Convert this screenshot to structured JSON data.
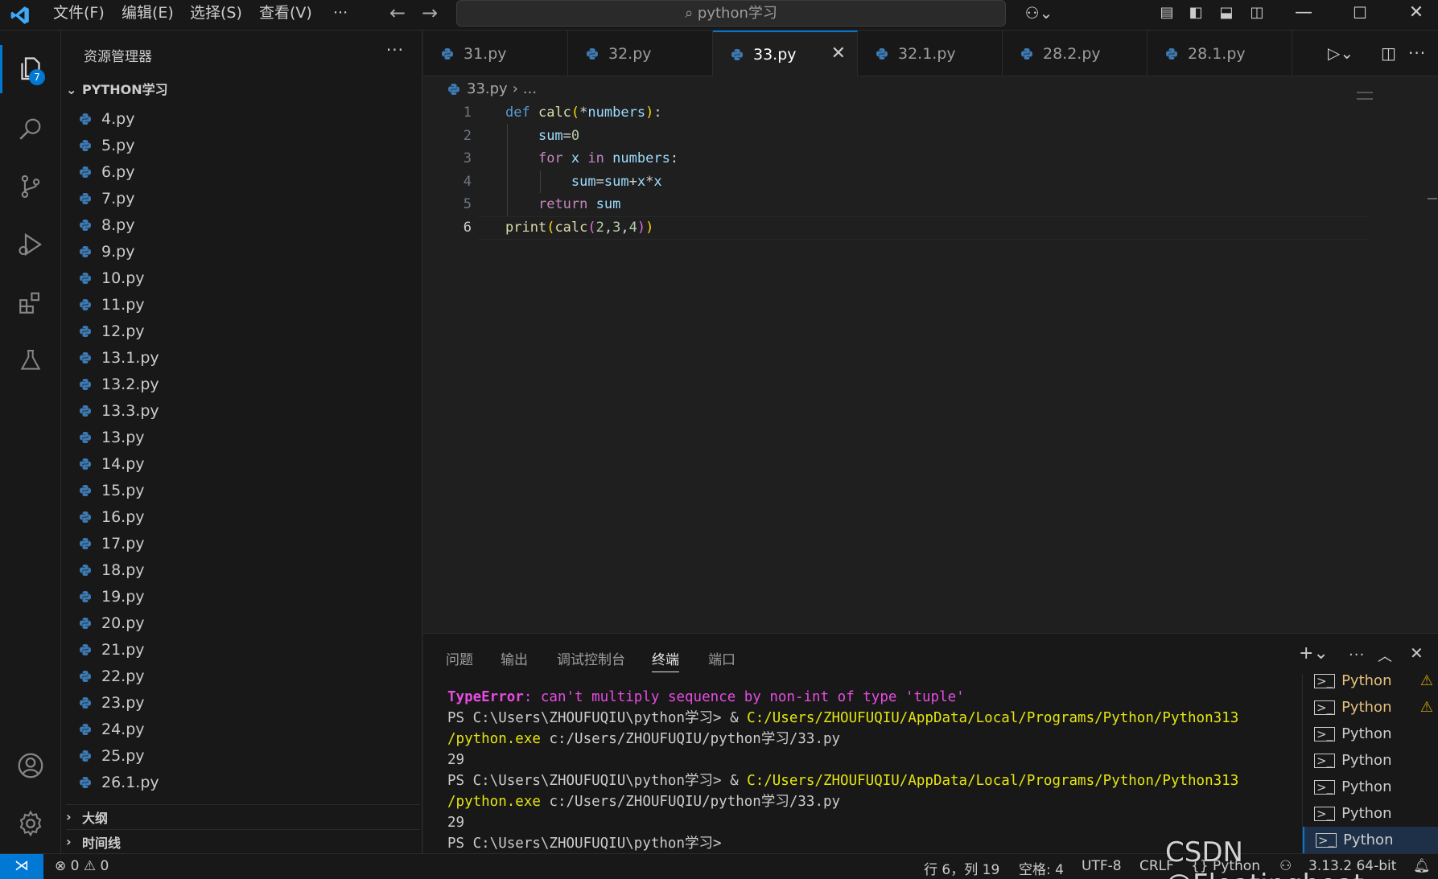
{
  "titlebar": {
    "menus": [
      "文件(F)",
      "编辑(E)",
      "选择(S)",
      "查看(V)",
      "···"
    ],
    "search": "python学习"
  },
  "activity": {
    "explorer_badge": "7"
  },
  "sidebar": {
    "title": "资源管理器",
    "more": "···",
    "folder": "PYTHON学习",
    "files": [
      "4.py",
      "5.py",
      "6.py",
      "7.py",
      "8.py",
      "9.py",
      "10.py",
      "11.py",
      "12.py",
      "13.1.py",
      "13.2.py",
      "13.3.py",
      "13.py",
      "14.py",
      "15.py",
      "16.py",
      "17.py",
      "18.py",
      "19.py",
      "20.py",
      "21.py",
      "22.py",
      "23.py",
      "24.py",
      "25.py",
      "26.1.py"
    ],
    "outline": "大纲",
    "timeline": "时间线"
  },
  "tabs": [
    "31.py",
    "32.py",
    "33.py",
    "32.1.py",
    "28.2.py",
    "28.1.py"
  ],
  "active_tab": "33.py",
  "breadcrumb": {
    "file": "33.py",
    "rest": "..."
  },
  "editor": {
    "line_numbers": [
      "1",
      "2",
      "3",
      "4",
      "5",
      "6"
    ],
    "lines": [
      "def calc(*numbers):",
      "    sum=0",
      "    for x in numbers:",
      "        sum=sum+x*x",
      "    return sum",
      "print(calc(2,3,4))"
    ]
  },
  "panel": {
    "tabs": [
      "问题",
      "输出",
      "调试控制台",
      "终端",
      "端口"
    ],
    "active_tab": "终端",
    "terminal": {
      "err_type": "TypeError",
      "err_msg": ": can't multiply sequence by non-int of type 'tuple'",
      "prompt": "PS C:\\Users\\ZHOUFUQIU\\python学习> ",
      "amp": "& ",
      "exe_path_1": "C:/Users/ZHOUFUQIU/AppData/Local/Programs/Python/Python313",
      "exe_path_2": "/python.exe",
      "script_path": " c:/Users/ZHOUFUQIU/python学习/33.py",
      "output": "29",
      "final_prompt": "PS C:\\Users\\ZHOUFUQIU\\python学习>"
    },
    "terminal_list": [
      "Python",
      "Python",
      "Python",
      "Python",
      "Python",
      "Python",
      "Python"
    ]
  },
  "statusbar": {
    "errors": "0",
    "warnings": "0",
    "position": "行 6，列 19",
    "spaces": "空格: 4",
    "encoding": "UTF-8",
    "eol": "CRLF",
    "language": "Python",
    "interpreter": "3.13.2 64-bit"
  },
  "watermark": "CSDN @Floatingboat",
  "colors": {
    "accent": "#0078d4",
    "background": "#1f1f1f",
    "keyword": "#569cd6",
    "function": "#dcdcaa",
    "error": "#e64ce1",
    "path": "#e5e510"
  }
}
